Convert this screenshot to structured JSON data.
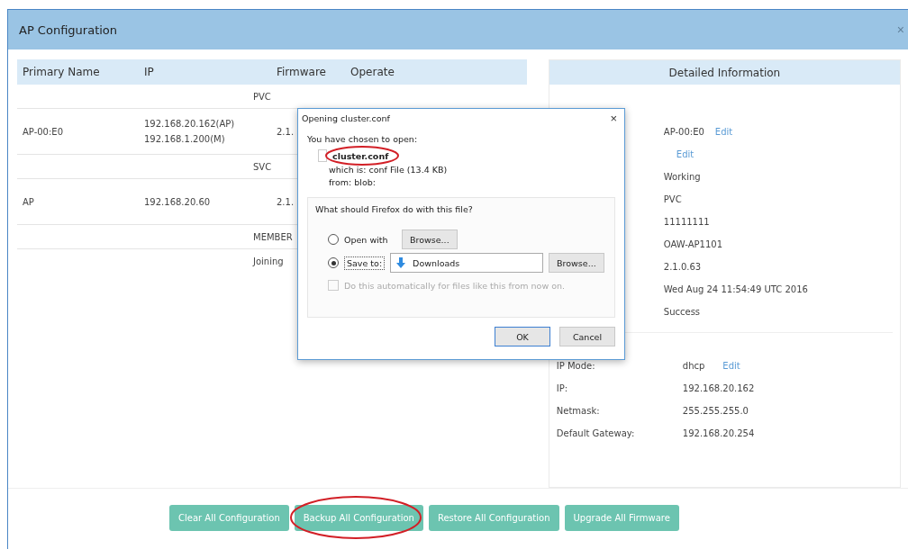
{
  "modal": {
    "title": "AP Configuration",
    "close": "×"
  },
  "ap_table": {
    "columns": [
      "Primary Name",
      "IP",
      "Firmware",
      "Operate"
    ],
    "rows": [
      {
        "kind": "group",
        "label": "PVC"
      },
      {
        "kind": "ap",
        "name": "AP-00:E0",
        "ip": [
          "192.168.20.162(AP)",
          "192.168.1.200(M)"
        ],
        "firmware": "2.1."
      },
      {
        "kind": "group",
        "label": "SVC"
      },
      {
        "kind": "ap",
        "name": "AP",
        "ip": [
          "192.168.20.60"
        ],
        "firmware": "2.1."
      },
      {
        "kind": "group",
        "label": "MEMBER"
      },
      {
        "kind": "status",
        "label": "Joining"
      }
    ]
  },
  "details": {
    "title": "Detailed Information",
    "rows": [
      {
        "value": "AP-00:E0",
        "action": "Edit"
      },
      {
        "action": "Edit"
      },
      {
        "value": "Working"
      },
      {
        "value": "PVC"
      },
      {
        "value": "11111111"
      },
      {
        "value": "OAW-AP1101"
      },
      {
        "value": "2.1.0.63"
      },
      {
        "value": "Wed Aug 24 11:54:49 UTC 2016"
      },
      {
        "value": "Success"
      }
    ],
    "network": [
      {
        "label": "IP Mode:",
        "value": "dhcp",
        "action": "Edit"
      },
      {
        "label": "IP:",
        "value": "192.168.20.162"
      },
      {
        "label": "Netmask:",
        "value": "255.255.255.0"
      },
      {
        "label": "Default Gateway:",
        "value": "192.168.20.254"
      }
    ]
  },
  "buttons": [
    {
      "label": "Clear All Configuration",
      "circled": false
    },
    {
      "label": "Backup All Configuration",
      "circled": true
    },
    {
      "label": "Restore All Configuration",
      "circled": false
    },
    {
      "label": "Upgrade All Firmware",
      "circled": false
    }
  ],
  "dialog": {
    "title": "Opening cluster.conf",
    "close": "×",
    "intro": "You have chosen to open:",
    "file": {
      "name": "cluster.conf",
      "circled": true
    },
    "type_label": "which is:",
    "type_value": "conf File (13.4 KB)",
    "from_label": "from:",
    "from_value": "blob:",
    "question": "What should Firefox do with this file?",
    "options": [
      {
        "kind": "open",
        "label": "Open with",
        "selected": false,
        "browse": "Browse..."
      },
      {
        "kind": "save",
        "label": "Save to:",
        "selected": true,
        "folder": "Downloads",
        "browse": "Browse..."
      }
    ],
    "auto": {
      "label": "Do this automatically for files like this from now on.",
      "checked": false,
      "disabled": true
    },
    "buttons": [
      {
        "label": "OK",
        "focused": true
      },
      {
        "label": "Cancel",
        "focused": false
      }
    ]
  }
}
